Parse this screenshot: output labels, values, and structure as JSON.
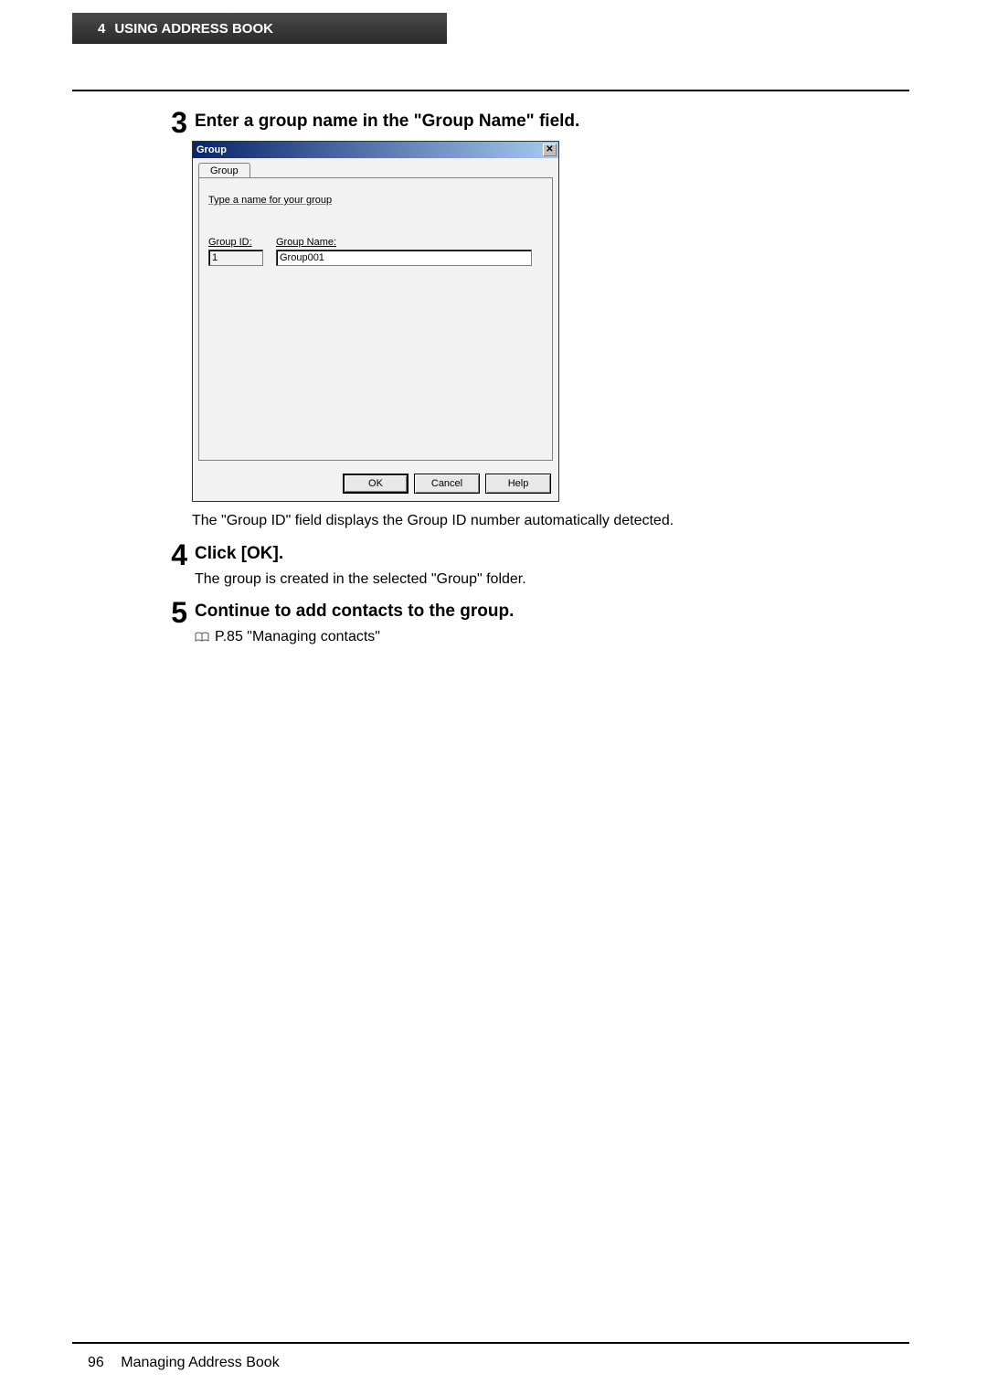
{
  "header": {
    "chapter_num": "4",
    "chapter_title": "USING ADDRESS BOOK"
  },
  "steps": [
    {
      "num": "3",
      "title": "Enter a group name in the \"Group Name\" field.",
      "after_text": "The \"Group ID\" field displays the Group ID number automatically detected."
    },
    {
      "num": "4",
      "title": "Click [OK].",
      "body": "The group is created in the selected \"Group\" folder."
    },
    {
      "num": "5",
      "title": "Continue to add contacts to the group.",
      "link_text": "P.85 \"Managing contacts\""
    }
  ],
  "dialog": {
    "title": "Group",
    "close_label": "✕",
    "tab_label": "Group",
    "hint": "Type a name for your group",
    "group_id_label": "Group ID:",
    "group_id_value": "1",
    "group_name_label": "Group Name:",
    "group_name_value": "Group001",
    "buttons": {
      "ok": "OK",
      "cancel": "Cancel",
      "help": "Help"
    }
  },
  "footer": {
    "page": "96",
    "section": "Managing Address Book"
  }
}
